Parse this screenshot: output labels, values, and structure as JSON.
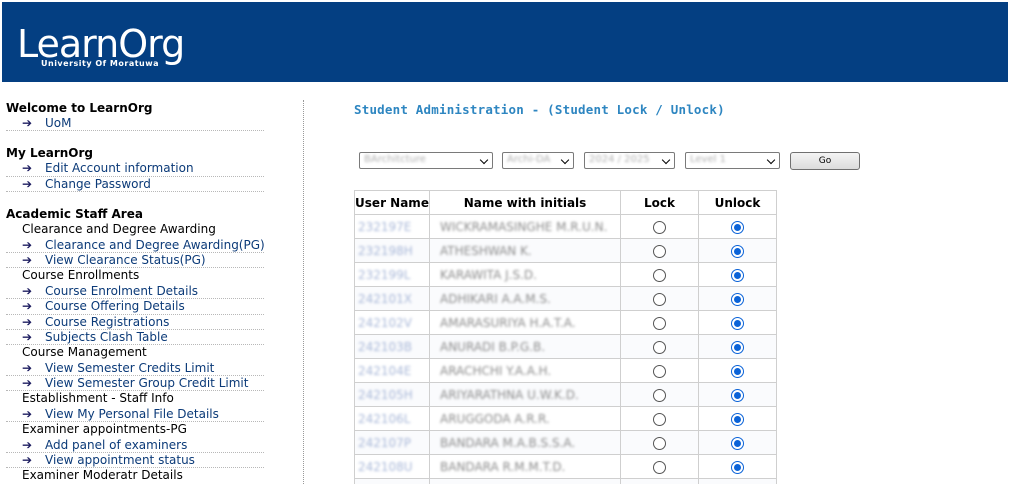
{
  "header": {
    "logo_title": "LearnOrg",
    "logo_subtitle": "University Of Moratuwa",
    "bg_color": "#043f82"
  },
  "sidebar": {
    "welcome": {
      "title": "Welcome to LearnOrg",
      "links": [
        "UoM"
      ]
    },
    "my_learnorg": {
      "title": "My LearnOrg",
      "links": [
        "Edit Account information",
        "Change Password"
      ]
    },
    "academic": {
      "title": "Academic Staff Area",
      "groups": [
        {
          "head": "Clearance and Degree Awarding",
          "links": [
            "Clearance and Degree Awarding(PG)",
            "View Clearance Status(PG)"
          ]
        },
        {
          "head": "Course Enrollments",
          "links": [
            "Course Enrolment Details",
            "Course Offering Details",
            "Course Registrations",
            "Subjects Clash Table"
          ]
        },
        {
          "head": "Course Management",
          "links": [
            "View Semester Credits Limit",
            "View Semester Group Credit Limit"
          ]
        },
        {
          "head": "Establishment - Staff Info",
          "links": [
            "View My Personal File Details"
          ]
        },
        {
          "head": "Examiner appointments-PG",
          "links": [
            "Add panel of examiners",
            "View appointment status"
          ]
        },
        {
          "head": "Examiner Moderatr Details",
          "links": []
        }
      ]
    }
  },
  "main": {
    "title": "Student Administration - (Student Lock / Unlock)",
    "filters": {
      "program": "BArchitcture",
      "department": "Archi-DA",
      "year": "2024 / 2025",
      "level": "Level 1",
      "go_label": "Go"
    },
    "table": {
      "headers": [
        "User Name",
        "Name with initials",
        "Lock",
        "Unlock"
      ],
      "rows": [
        {
          "user": "232197E",
          "name": "WICKRAMASINGHE M.R.U.N.",
          "locked": false
        },
        {
          "user": "232198H",
          "name": "ATHESHWAN K.",
          "locked": false
        },
        {
          "user": "232199L",
          "name": "KARAWITA J.S.D.",
          "locked": false
        },
        {
          "user": "242101X",
          "name": "ADHIKARI A.A.M.S.",
          "locked": false
        },
        {
          "user": "242102V",
          "name": "AMARASURIYA H.A.T.A.",
          "locked": false
        },
        {
          "user": "242103B",
          "name": "ANURADI B.P.G.B.",
          "locked": false
        },
        {
          "user": "242104E",
          "name": "ARACHCHI Y.A.A.H.",
          "locked": false
        },
        {
          "user": "242105H",
          "name": "ARIYARATHNA U.W.K.D.",
          "locked": false
        },
        {
          "user": "242106L",
          "name": "ARUGGODA A.R.R.",
          "locked": false
        },
        {
          "user": "242107P",
          "name": "BANDARA M.A.B.S.S.A.",
          "locked": false
        },
        {
          "user": "242108U",
          "name": "BANDARA R.M.M.T.D.",
          "locked": false
        },
        {
          "user": "",
          "name": "",
          "locked": false
        }
      ]
    }
  }
}
